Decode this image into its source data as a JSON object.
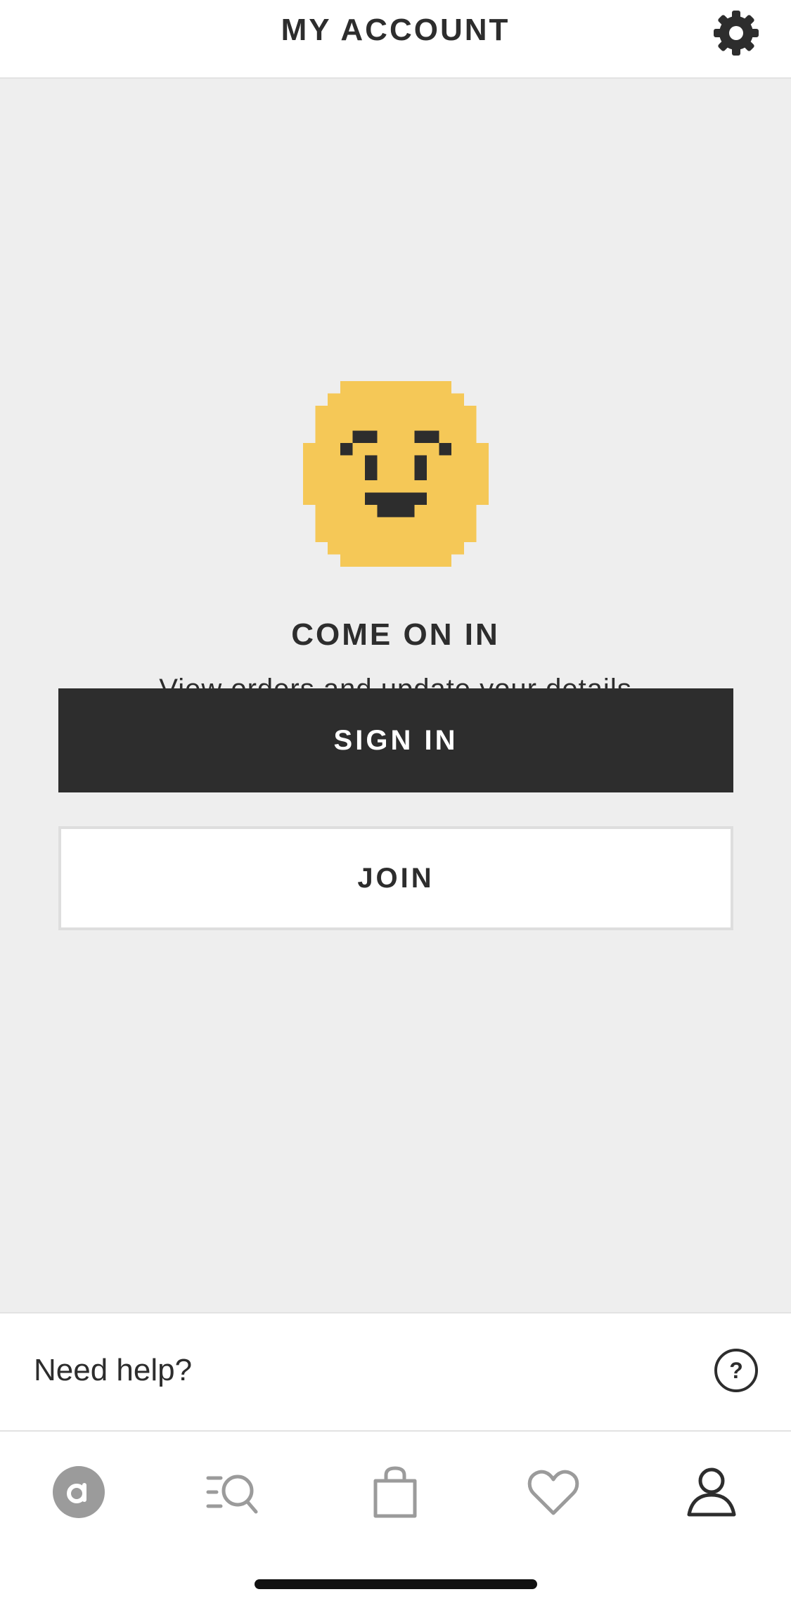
{
  "header": {
    "title": "MY ACCOUNT",
    "settings_icon": "gear-icon"
  },
  "main": {
    "illustration": "pixel-smiley-face",
    "heading": "COME ON IN",
    "subtext": "View orders and update your details",
    "sign_in_label": "SIGN IN",
    "join_label": "JOIN"
  },
  "help": {
    "label": "Need help?",
    "icon": "question-circle-icon"
  },
  "tabbar": {
    "items": [
      {
        "name": "home",
        "icon": "brand-logo-icon",
        "active": false
      },
      {
        "name": "search",
        "icon": "search-icon",
        "active": false
      },
      {
        "name": "bag",
        "icon": "shopping-bag-icon",
        "active": false
      },
      {
        "name": "saved",
        "icon": "heart-icon",
        "active": false
      },
      {
        "name": "account",
        "icon": "user-icon",
        "active": true
      }
    ]
  },
  "colors": {
    "primary": "#2d2d2d",
    "background": "#eeeeee",
    "emoji_yellow": "#f5c857",
    "inactive_icon": "#9b9b9b"
  }
}
